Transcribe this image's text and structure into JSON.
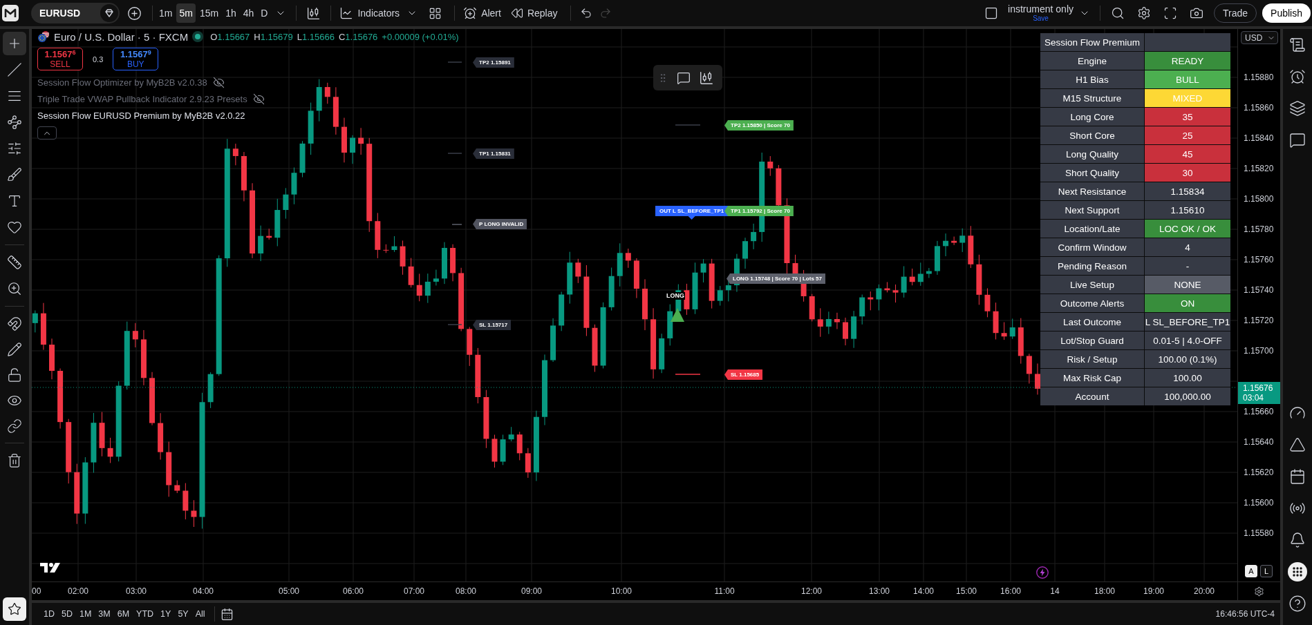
{
  "top_bar": {
    "symbol": "EURUSD",
    "intervals": [
      {
        "label": "1m",
        "selected": false
      },
      {
        "label": "5m",
        "selected": true
      },
      {
        "label": "15m",
        "selected": false
      },
      {
        "label": "1h",
        "selected": false
      },
      {
        "label": "4h",
        "selected": false
      },
      {
        "label": "D",
        "selected": false
      }
    ],
    "indicators_button": "Indicators",
    "alert_button": "Alert",
    "replay_button": "Replay",
    "history": [
      {
        "disabled": false
      },
      {
        "disabled": true
      }
    ],
    "layout_name": "instrument only",
    "save_label": "Save",
    "trade_button": "Trade",
    "publish_button": "Publish"
  },
  "drawing_tools": [
    {
      "selected": true
    },
    {
      "selected": false
    },
    {
      "selected": false
    },
    {
      "selected": false
    },
    {
      "selected": false
    },
    {
      "selected": false
    },
    {
      "selected": false
    },
    {
      "selected": false
    },
    {
      "selected": false
    },
    {
      "selected": false
    }
  ],
  "legend": {
    "title": "Euro / U.S. Dollar · 5 · FXCM",
    "ohlc": [
      {
        "label": "O",
        "value": "1.15667"
      },
      {
        "label": "H",
        "value": "1.15679"
      },
      {
        "label": "L",
        "value": "1.15666"
      },
      {
        "label": "C",
        "value": "1.15676"
      }
    ],
    "change": "+0.00009 (+0.01%)",
    "sell": {
      "price": "1.1567$^{6}$",
      "label": "SELL"
    },
    "spread": "0.3",
    "buy": {
      "price": "1.1567$^{9}$",
      "label": "BUY"
    },
    "indicators": [
      {
        "name": "Session Flow Optimizer by MyB2B v2.0.38",
        "hidden": true
      },
      {
        "name": "Triple Trade VWAP Pullback Indicator 2.9.23 Presets",
        "hidden": true
      },
      {
        "name": "Session Flow EURUSD Premium by MyB2B v2.0.22",
        "hidden": false
      }
    ]
  },
  "chart_labels": [
    {
      "kind": "tag",
      "text": "TP2 1.15891",
      "color": "#2a2e39"
    },
    {
      "kind": "tag",
      "text": "TP1 1.15831",
      "color": "#2a2e39"
    },
    {
      "kind": "tag",
      "text": "P LONG INVALID",
      "color": "#50535e"
    },
    {
      "kind": "tag",
      "text": "SL 1.15717",
      "color": "#2a2e39"
    },
    {
      "kind": "tag",
      "text": "TP2 1.15850 | Score 70",
      "color": "#4caf50"
    },
    {
      "kind": "callout",
      "text": "OUT L SL_BEFORE_TP1",
      "color": "#2962ff"
    },
    {
      "kind": "tag",
      "text": "TP1 1.15792 | Score 70",
      "color": "#4caf50"
    },
    {
      "kind": "tag",
      "text": "LONG 1.15748 | Score 70 | Lots 57",
      "color": "#5d606b"
    },
    {
      "kind": "tag",
      "text": "SL 1.15685",
      "color": "#f23645"
    }
  ],
  "signal_label": "LONG",
  "session_table": {
    "title": "Session Flow Premium",
    "rows": [
      {
        "label": "Engine",
        "value": "READY",
        "color": "#388e3c"
      },
      {
        "label": "H1 Bias",
        "value": "BULL",
        "color": "#4caf50"
      },
      {
        "label": "M15 Structure",
        "value": "MIXED",
        "color": "#fdd835"
      },
      {
        "label": "Long Core",
        "value": "35",
        "color": "#c9303c"
      },
      {
        "label": "Short Core",
        "value": "25",
        "color": "#c9303c"
      },
      {
        "label": "Long Quality",
        "value": "45",
        "color": "#c9303c"
      },
      {
        "label": "Short Quality",
        "value": "30",
        "color": "#c9303c"
      },
      {
        "label": "Next Resistance",
        "value": "1.15834",
        "color": "#363a45"
      },
      {
        "label": "Next Support",
        "value": "1.15610",
        "color": "#363a45"
      },
      {
        "label": "Location/Late",
        "value": "LOC OK / OK",
        "color": "#388e3c"
      },
      {
        "label": "Confirm Window",
        "value": "4",
        "color": "#363a45"
      },
      {
        "label": "Pending Reason",
        "value": "-",
        "color": "#363a45"
      },
      {
        "label": "Live Setup",
        "value": "NONE",
        "color": "#575b66"
      },
      {
        "label": "Outcome Alerts",
        "value": "ON",
        "color": "#388e3c"
      },
      {
        "label": "Last Outcome",
        "value": "L SL_BEFORE_TP1",
        "color": "#363a45"
      },
      {
        "label": "Lot/Stop Guard",
        "value": "0.01-5 | 4.0-OFF",
        "color": "#363a45"
      },
      {
        "label": "Risk / Setup",
        "value": "100.00 (0.1%)",
        "color": "#363a45"
      },
      {
        "label": "Max Risk Cap",
        "value": "100.00",
        "color": "#363a45"
      },
      {
        "label": "Account",
        "value": "100,000.00",
        "color": "#363a45"
      }
    ]
  },
  "price_axis": {
    "currency": "USD",
    "labels": [
      "1.15880",
      "1.15860",
      "1.15840",
      "1.15820",
      "1.15800",
      "1.15780",
      "1.15760",
      "1.15740",
      "1.15720",
      "1.15700",
      "1.15660",
      "1.15640",
      "1.15620",
      "1.15600",
      "1.15580"
    ],
    "current_price": "1.15676",
    "countdown": "03:04"
  },
  "scale_buttons": [
    {
      "label": "A",
      "selected": true
    },
    {
      "label": "L",
      "selected": false
    }
  ],
  "time_axis": {
    "labels": [
      "00",
      "02:00",
      "03:00",
      "04:00",
      "05:00",
      "06:00",
      "07:00",
      "08:00",
      "09:00",
      "10:00",
      "11:00",
      "12:00",
      "13:00",
      "14:00",
      "15:00",
      "16:00",
      "14",
      "18:00",
      "19:00",
      "20:00"
    ]
  },
  "bottom_bar": {
    "ranges": [
      "1D",
      "5D",
      "1M",
      "3M",
      "6M",
      "YTD",
      "1Y",
      "5Y",
      "All"
    ],
    "clock": "16:46:56 UTC-4"
  }
}
